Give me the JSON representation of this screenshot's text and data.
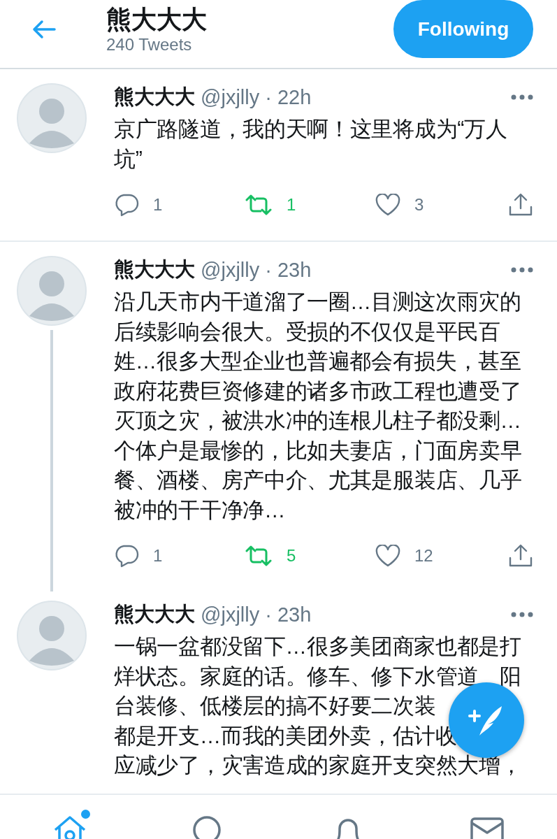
{
  "header": {
    "title": "熊大大大",
    "subtitle": "240 Tweets",
    "follow_button": {
      "label": "Following",
      "following": true
    }
  },
  "tweets": [
    {
      "name": "熊大大大",
      "handle": "@jxjlly",
      "time": "· 22h",
      "lines": [
        "京广路隧道，我的天啊！这里将成为“万人",
        "坑”"
      ],
      "connected_to_next": false,
      "replies": "1",
      "retweets": "1",
      "retweeted": true,
      "likes": "3",
      "liked": false
    },
    {
      "name": "熊大大大",
      "handle": "@jxjlly",
      "time": "· 23h",
      "lines": [
        "沿几天市内干道溜了一圈…目测这次雨灾的",
        "后续影响会很大。受损的不仅仅是平民百",
        "姓…很多大型企业也普遍都会有损失，甚至",
        "政府花费巨资修建的诸多市政工程也遭受了",
        "灭顶之灾，被洪水冲的连根儿柱子都没剩…",
        "个体户是最惨的，比如夫妻店，门面房卖早",
        "餐、酒楼、房产中介、尤其是服装店、几乎",
        "被冲的干干净净…"
      ],
      "connected_to_next": true,
      "replies": "1",
      "retweets": "5",
      "retweeted": true,
      "likes": "12",
      "liked": false
    },
    {
      "name": "熊大大大",
      "handle": "@jxjlly",
      "time": "· 23h",
      "lines": [
        "一锅一盆都没留下…很多美团商家也都是打",
        [
          "烊状态。家庭的话。修车、修下水管道",
          "阳"
        ],
        "台装修、低楼层的搞不好要二次装",
        "都是开支…而我的美团外卖，估计收",
        "应减少了，灾害造成的家庭开支突然大增，"
      ],
      "connected_to_next": false
    }
  ],
  "bottom_nav": [
    {
      "kind": "home",
      "selected": true,
      "badge": true
    },
    {
      "kind": "search",
      "selected": false,
      "badge": false
    },
    {
      "kind": "notifications",
      "selected": false,
      "badge": false
    },
    {
      "kind": "messages",
      "selected": false,
      "badge": false
    }
  ]
}
